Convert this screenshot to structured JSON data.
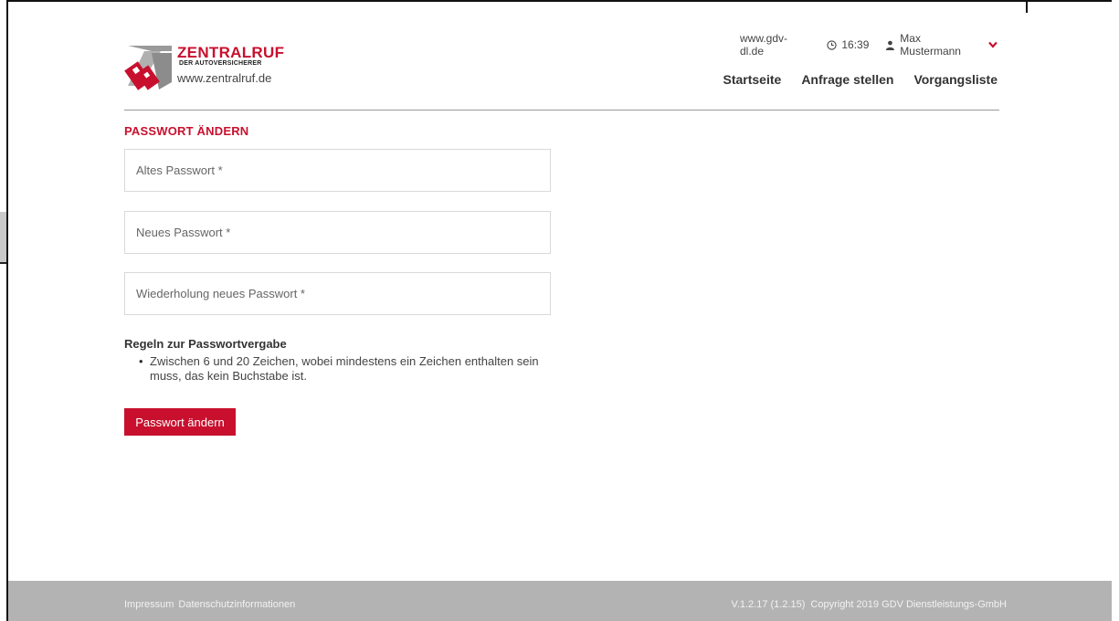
{
  "header": {
    "brand": "ZENTRALRUF",
    "brand_sub": "DER AUTOVERSICHERER",
    "brand_url": "www.zentralruf.de",
    "link_gdv": "www.gdv-dl.de",
    "time": "16:39",
    "user_name": "Max Mustermann",
    "nav": {
      "home": "Startseite",
      "request": "Anfrage stellen",
      "list": "Vorgangsliste"
    }
  },
  "main": {
    "title": "PASSWORT ÄNDERN",
    "fields": {
      "old_password_placeholder": "Altes Passwort *",
      "new_password_placeholder": "Neues Passwort *",
      "repeat_password_placeholder": "Wiederholung neues Passwort *"
    },
    "rules_title": "Regeln zur Passwortvergabe",
    "rules": [
      "Zwischen 6 und 20 Zeichen, wobei mindestens ein Zeichen enthalten sein muss, das kein Buchstabe ist."
    ],
    "submit_label": "Passwort ändern"
  },
  "footer": {
    "imprint": "Impressum",
    "privacy": "Datenschutzinformationen",
    "version": "V.1.2.17 (1.2.15)",
    "copyright": "Copyright 2019 GDV Dienstleistungs-GmbH"
  },
  "colors": {
    "accent": "#c8102e",
    "footer_bg": "#b3b3b3",
    "rule": "#999999"
  },
  "icons": {
    "clock": "clock-icon",
    "user": "user-icon",
    "caret": "chevron-down-icon"
  }
}
